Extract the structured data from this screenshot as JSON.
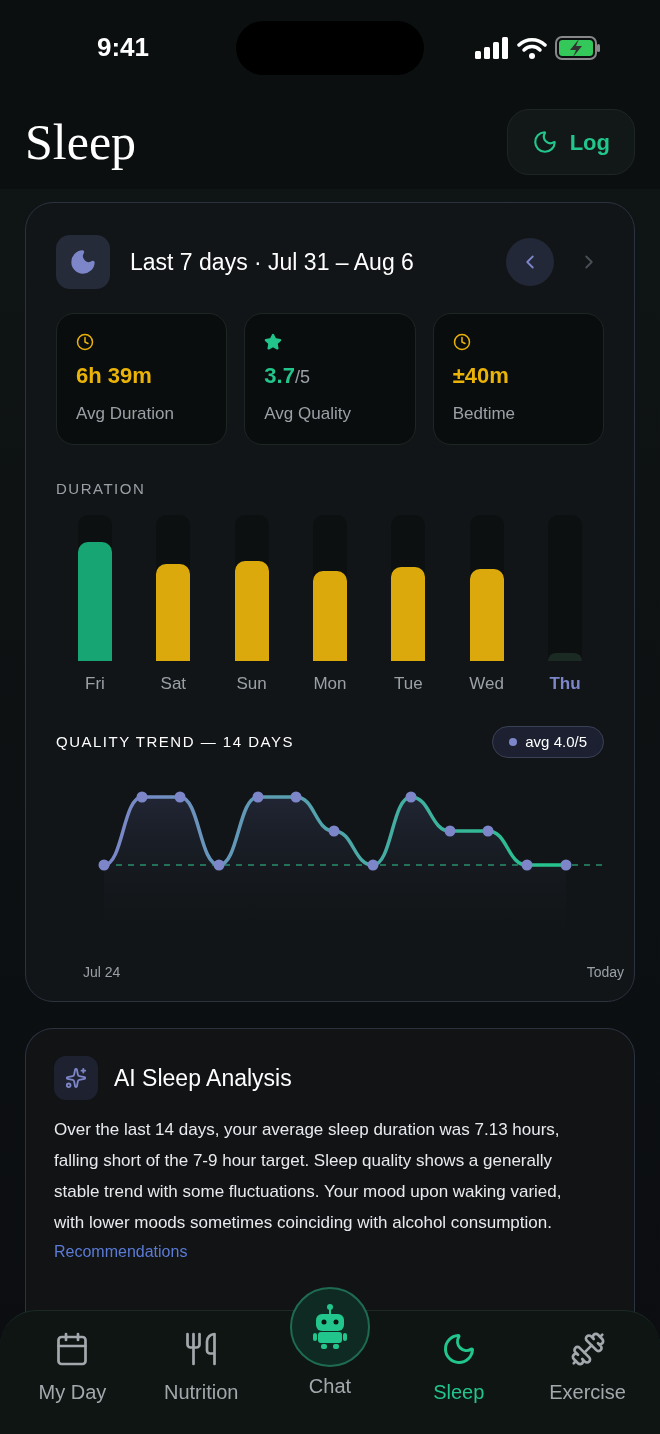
{
  "status_bar": {
    "time": "9:41"
  },
  "header": {
    "title": "Sleep",
    "log_button": "Log"
  },
  "summary": {
    "range": "Last 7 days · Jul 31 – Aug 6",
    "prev_enabled": true,
    "next_enabled": false,
    "stats": [
      {
        "kind": "clock",
        "color": "#eab308",
        "value": "6h 39m",
        "label": "Avg Duration"
      },
      {
        "kind": "star",
        "color": "#22c58b",
        "value": "3.7",
        "suffix": "/5",
        "label": "Avg Quality"
      },
      {
        "kind": "clock",
        "color": "#eab308",
        "value": "±40m",
        "label": "Bedtime"
      }
    ],
    "duration_title": "DURATION",
    "days": [
      {
        "label": "Fri",
        "level": 0.81,
        "color": "#17a673",
        "selected": false
      },
      {
        "label": "Sat",
        "level": 0.66,
        "color": "#dca90c",
        "selected": false
      },
      {
        "label": "Sun",
        "level": 0.68,
        "color": "#dca90c",
        "selected": false
      },
      {
        "label": "Mon",
        "level": 0.61,
        "color": "#dca90c",
        "selected": false
      },
      {
        "label": "Tue",
        "level": 0.64,
        "color": "#dca90c",
        "selected": false
      },
      {
        "label": "Wed",
        "level": 0.63,
        "color": "#dca90c",
        "selected": false
      },
      {
        "label": "Thu",
        "level": 0.05,
        "color": "#1c2a24",
        "selected": true
      }
    ],
    "trend_title": "QUALITY TREND — 14 DAYS",
    "trend_badge": "avg 4.0/5",
    "trend_start": "Jul 24",
    "trend_end": "Today"
  },
  "analysis": {
    "title": "AI Sleep Analysis",
    "text": "Over the last 14 days, your average sleep duration was 7.13 hours, falling short of the 7-9 hour target. Sleep quality shows a generally stable trend with some fluctuations. Your mood upon waking varied, with lower moods sometimes coinciding with alcohol consumption.",
    "link": "Recommendations"
  },
  "nav": [
    {
      "kind": "calendar",
      "label": "My Day",
      "selected": false
    },
    {
      "kind": "fork",
      "label": "Nutrition",
      "selected": false
    },
    {
      "kind": "robot",
      "label": "Chat",
      "selected": false
    },
    {
      "kind": "moon",
      "label": "Sleep",
      "selected": true
    },
    {
      "kind": "dumbbell",
      "label": "Exercise",
      "selected": false
    }
  ]
}
